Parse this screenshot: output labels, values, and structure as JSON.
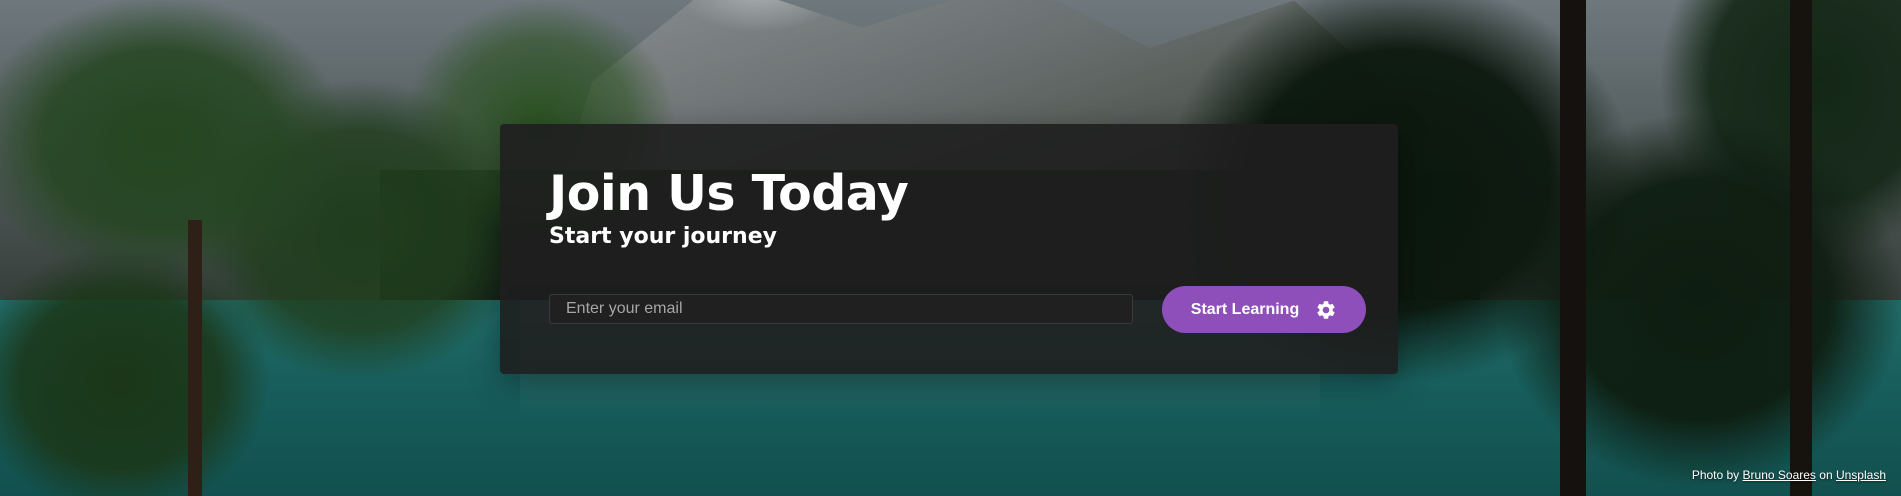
{
  "hero": {
    "title": "Join Us Today",
    "subtitle": "Start your journey",
    "email_placeholder": "Enter your email",
    "cta_label": "Start Learning",
    "cta_icon": "gear-icon",
    "cta_color": "#8e4fba",
    "card_color": "#1e1e1e"
  },
  "credit": {
    "prefix": "Photo by",
    "author": "Bruno Soares",
    "connector": "on",
    "source": "Unsplash"
  }
}
